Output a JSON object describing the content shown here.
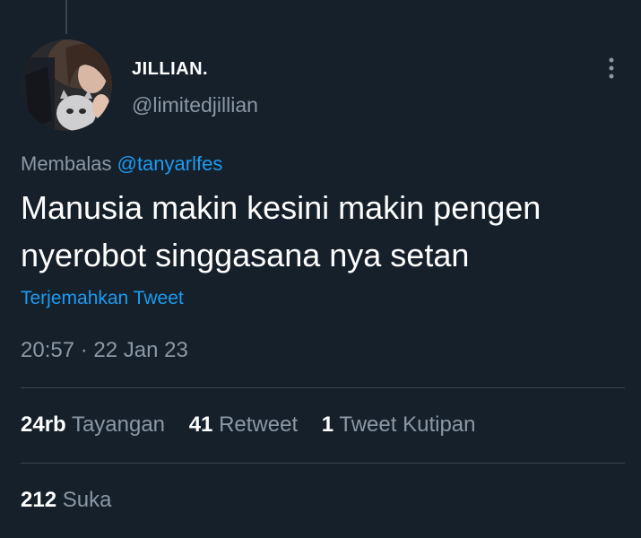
{
  "author": {
    "display_name": "JILLIAN.",
    "handle": "@limitedjillian",
    "avatar_icon": "profile-photo"
  },
  "menu": {
    "icon": "more-vertical-icon"
  },
  "reply": {
    "prefix": "Membalas",
    "mention": "@tanyarlfes"
  },
  "tweet": {
    "text": "Manusia makin kesini makin pengen nyerobot singgasana nya setan",
    "translate_label": "Terjemahkan Tweet",
    "timestamp": "20:57 · 22 Jan 23"
  },
  "stats": {
    "views": {
      "count": "24rb",
      "label": "Tayangan"
    },
    "retweets": {
      "count": "41",
      "label": "Retweet"
    },
    "quotes": {
      "count": "1",
      "label": "Tweet Kutipan"
    },
    "likes": {
      "count": "212",
      "label": "Suka"
    }
  },
  "colors": {
    "background": "#15202b",
    "accent": "#1d9bf0",
    "secondary_text": "#8b98a5",
    "divider": "#38444d"
  }
}
